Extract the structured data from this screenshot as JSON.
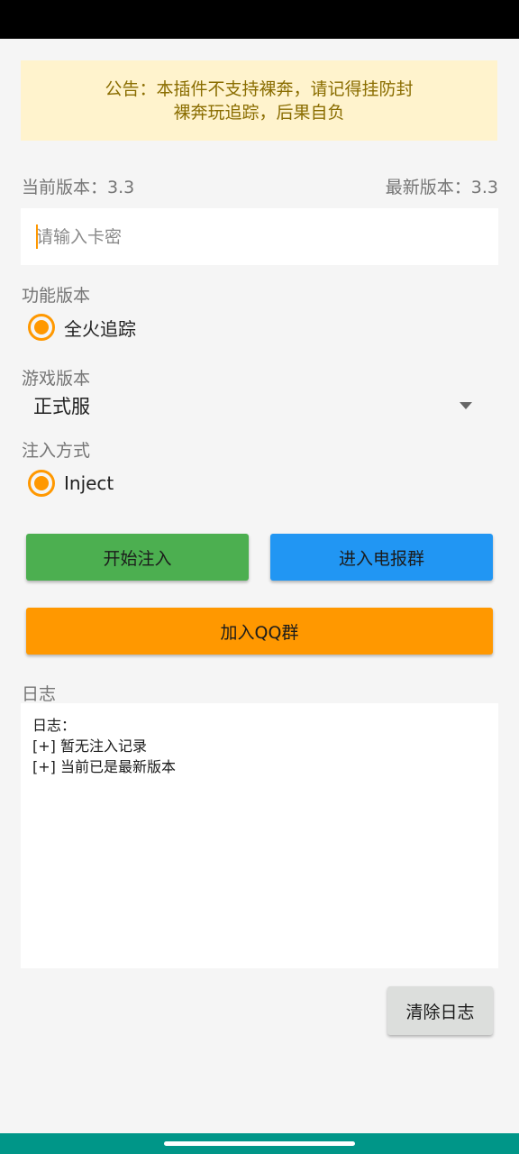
{
  "notice": {
    "line1": "公告：本插件不支持裸奔，请记得挂防封",
    "line2": "裸奔玩追踪，后果自负"
  },
  "version": {
    "current": "当前版本：3.3",
    "latest": "最新版本：3.3"
  },
  "key_input": {
    "placeholder": "请输入卡密",
    "value": ""
  },
  "feature": {
    "label": "功能版本",
    "options": [
      {
        "label": "全火追踪",
        "checked": true
      }
    ]
  },
  "game": {
    "label": "游戏版本",
    "selected": "正式服"
  },
  "inject": {
    "label": "注入方式",
    "options": [
      {
        "label": "Inject",
        "checked": true
      }
    ]
  },
  "buttons": {
    "start": "开始注入",
    "telegram": "进入电报群",
    "qq": "加入QQ群",
    "clear_log": "清除日志"
  },
  "log": {
    "label": "日志",
    "lines": [
      "日志：",
      "[+] 暂无注入记录",
      "[+] 当前已是最新版本"
    ]
  },
  "colors": {
    "accent": "#ff9800",
    "start_button": "#4caf50",
    "telegram_button": "#2196f3",
    "qq_button": "#ff9800",
    "notice_bg": "#fff3cd",
    "notice_text": "#8a6d00",
    "nav_bar": "#009688"
  }
}
